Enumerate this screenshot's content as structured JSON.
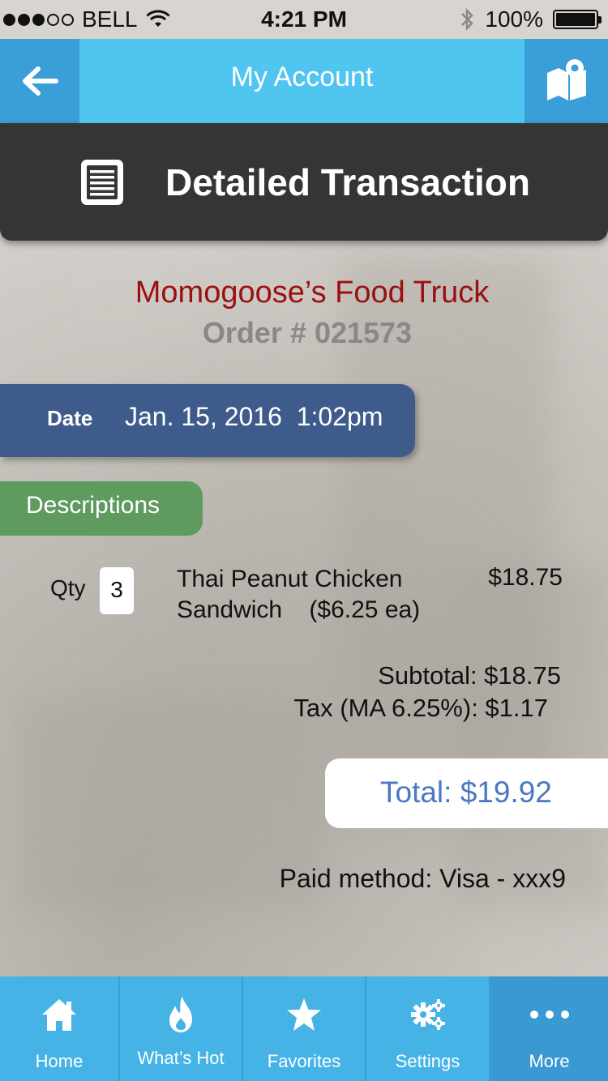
{
  "status_bar": {
    "carrier": "BELL",
    "time": "4:21 PM",
    "battery": "100%"
  },
  "nav": {
    "title": "My Account",
    "back_icon": "arrow-left-icon",
    "map_icon": "map-pin-icon"
  },
  "section": {
    "title": "Detailed Transaction",
    "icon": "document-icon"
  },
  "vendor": {
    "name": "Momogoose’s Food Truck",
    "order_number": "Order # 021573"
  },
  "date": {
    "label": "Date",
    "value": "Jan. 15, 2016  1:02pm"
  },
  "descriptions_label": "Descriptions",
  "items": [
    {
      "qty_label": "Qty",
      "qty": "3",
      "name_line1": "Thai Peanut Chicken",
      "name_line2": "Sandwich    ($6.25 ea)",
      "price": "$18.75"
    }
  ],
  "totals": {
    "subtotal": "Subtotal: $18.75",
    "tax": "Tax (MA 6.25%): $1.17",
    "total": "Total: $19.92"
  },
  "payment": {
    "method": "Paid method: Visa - xxx9"
  },
  "tabs": [
    {
      "label": "Home",
      "icon": "home-icon"
    },
    {
      "label": "What’s Hot",
      "icon": "flame-icon"
    },
    {
      "label": "Favorites",
      "icon": "star-icon"
    },
    {
      "label": "Settings",
      "icon": "gears-icon"
    },
    {
      "label": "More",
      "icon": "more-dots-icon"
    }
  ],
  "colors": {
    "nav": "#4fc5f0",
    "nav_button": "#3a9ed9",
    "header": "#353535",
    "vendor": "#9a1010",
    "date_pill": "#3f5b8c",
    "desc_pill": "#5f9a5e",
    "total": "#4a78c2",
    "tab": "#45b3e6"
  }
}
